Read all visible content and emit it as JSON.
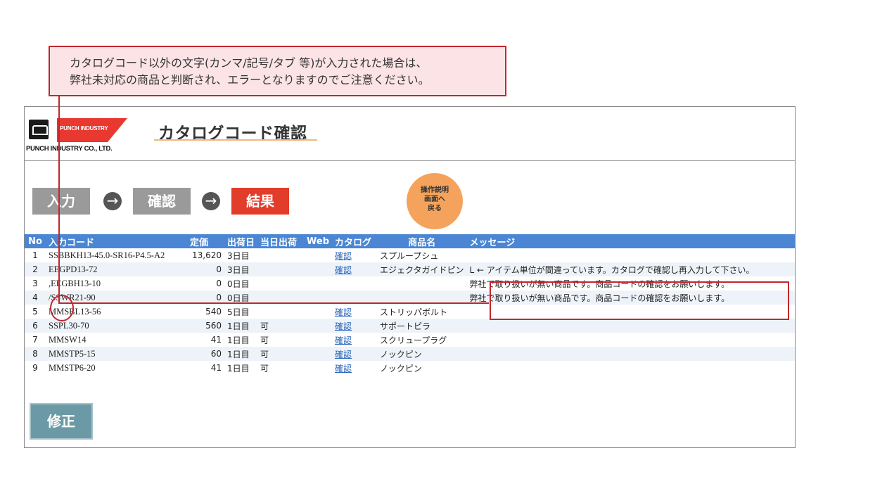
{
  "callout": {
    "line1": "カタログコード以外の文字(カンマ/記号/タブ 等)が入力された場合は、",
    "line2": "弊社未対応の商品と判断され、エラーとなりますのでご注意ください。"
  },
  "header": {
    "logo_text": "PUNCH INDUSTRY",
    "logo_subtext": "PUNCH INDUSTRY CO., LTD.",
    "title": "カタログコード確認"
  },
  "steps": [
    {
      "label": "入力",
      "state": "done"
    },
    {
      "label": "確認",
      "state": "done"
    },
    {
      "label": "結果",
      "state": "current"
    }
  ],
  "help_button": {
    "line1": "操作説明",
    "line2": "画面へ",
    "line3": "戻る"
  },
  "table": {
    "headers": [
      "No",
      "入力コード",
      "定価",
      "出荷日",
      "当日出荷",
      "Web",
      "カタログ",
      "商品名",
      "メッセージ"
    ],
    "rows": [
      {
        "no": "1",
        "code": "SSBBKH13-45.0-SR16-P4.5-A2",
        "price": "13,620",
        "ship": "3日目",
        "same_day": "",
        "web": "",
        "catalog": "確認",
        "name": "スプループシュ",
        "message": ""
      },
      {
        "no": "2",
        "code": "EEGPD13-72",
        "price": "0",
        "ship": "3日目",
        "same_day": "",
        "web": "",
        "catalog": "確認",
        "name": "エジェクタガイドピン",
        "message": "L ← アイテム単位が間違っています。カタログで確認し再入力して下さい。"
      },
      {
        "no": "3",
        "code": ",EEGBH13-10",
        "price": "0",
        "ship": "0日目",
        "same_day": "",
        "web": "",
        "catalog": "",
        "name": "",
        "message": "弊社で取り扱いが無い商品です。商品コードの確認をお願いします。"
      },
      {
        "no": "4",
        "code": "/SSWR21-90",
        "price": "0",
        "ship": "0日目",
        "same_day": "",
        "web": "",
        "catalog": "",
        "name": "",
        "message": "弊社で取り扱いが無い商品です。商品コードの確認をお願いします。"
      },
      {
        "no": "5",
        "code": "MMSBL13-56",
        "price": "540",
        "ship": "5日目",
        "same_day": "",
        "web": "",
        "catalog": "確認",
        "name": "ストリッパボルト",
        "message": ""
      },
      {
        "no": "6",
        "code": "SSPL30-70",
        "price": "560",
        "ship": "1日目",
        "same_day": "可",
        "web": "",
        "catalog": "確認",
        "name": "サポートピラ",
        "message": ""
      },
      {
        "no": "7",
        "code": "MMSW14",
        "price": "41",
        "ship": "1日目",
        "same_day": "可",
        "web": "",
        "catalog": "確認",
        "name": "スクリュープラグ",
        "message": ""
      },
      {
        "no": "8",
        "code": "MMSTP5-15",
        "price": "60",
        "ship": "1日目",
        "same_day": "可",
        "web": "",
        "catalog": "確認",
        "name": "ノックピン",
        "message": ""
      },
      {
        "no": "9",
        "code": "MMSTP6-20",
        "price": "41",
        "ship": "1日目",
        "same_day": "可",
        "web": "",
        "catalog": "確認",
        "name": "ノックピン",
        "message": ""
      }
    ]
  },
  "fix_button": {
    "label": "修正"
  },
  "colors": {
    "accent_blue": "#4a86d3",
    "alert_red": "#c0272d",
    "current_step": "#e23c2a",
    "help_orange": "#f5a35c"
  }
}
